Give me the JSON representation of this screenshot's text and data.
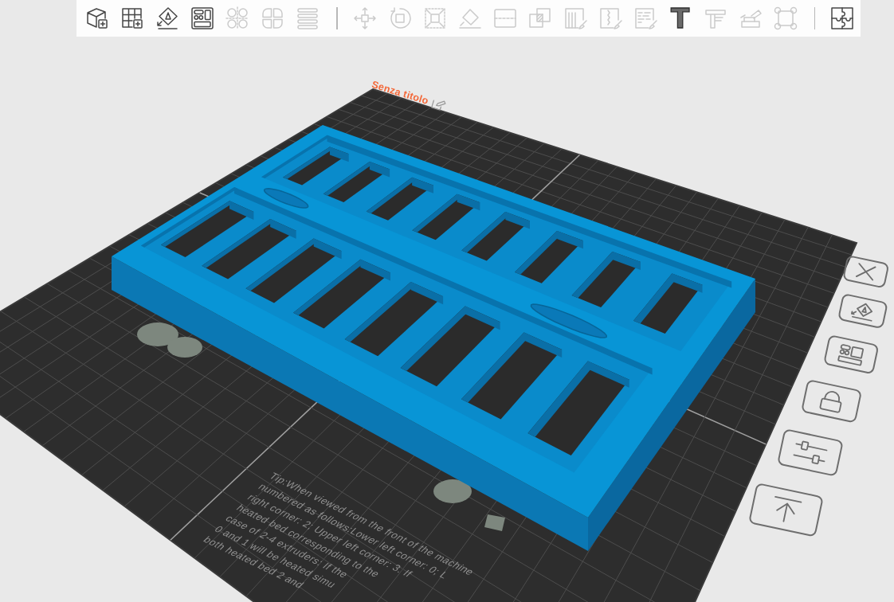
{
  "toolbar": {
    "groups": [
      {
        "tools": [
          {
            "kind": "cube",
            "disabled": false
          },
          {
            "kind": "plate",
            "disabled": false
          },
          {
            "kind": "orient",
            "disabled": false
          },
          {
            "kind": "arrange",
            "disabled": false
          },
          {
            "kind": "splitobjects",
            "disabled": true
          },
          {
            "kind": "splitparts",
            "disabled": true
          },
          {
            "kind": "layers",
            "disabled": true
          }
        ]
      },
      {
        "tools": [
          {
            "kind": "move",
            "disabled": true
          },
          {
            "kind": "rotate",
            "disabled": true
          },
          {
            "kind": "scale",
            "disabled": true
          },
          {
            "kind": "flatten",
            "disabled": true
          },
          {
            "kind": "cut",
            "disabled": true
          },
          {
            "kind": "boolean",
            "disabled": true
          },
          {
            "kind": "supports",
            "disabled": true
          },
          {
            "kind": "seam",
            "disabled": true
          },
          {
            "kind": "fuzzy",
            "disabled": true
          },
          {
            "kind": "text",
            "glyph": "T",
            "disabled": false
          },
          {
            "kind": "measure",
            "disabled": true
          },
          {
            "kind": "assembly",
            "disabled": true
          },
          {
            "kind": "brim",
            "disabled": true
          }
        ]
      },
      {
        "tools": [
          {
            "kind": "puzzle",
            "disabled": false
          }
        ]
      }
    ]
  },
  "plate": {
    "name": "Senza titolo",
    "tip": [
      "Tip:When viewed from the front of the machine",
      "numbered as follows:Lower left corner: 0; L",
      "right corner: 2; Upper left corner: 3. If",
      "heated bed corresponding to the",
      "case of 2-4 extruders: If the",
      "0 and 1 will be heated simu",
      "both heated bed 2 and"
    ],
    "buttons": [
      {
        "kind": "delete"
      },
      {
        "kind": "orient"
      },
      {
        "kind": "arrange"
      },
      {
        "kind": "lock"
      },
      {
        "kind": "settings"
      },
      {
        "kind": "top"
      }
    ]
  }
}
